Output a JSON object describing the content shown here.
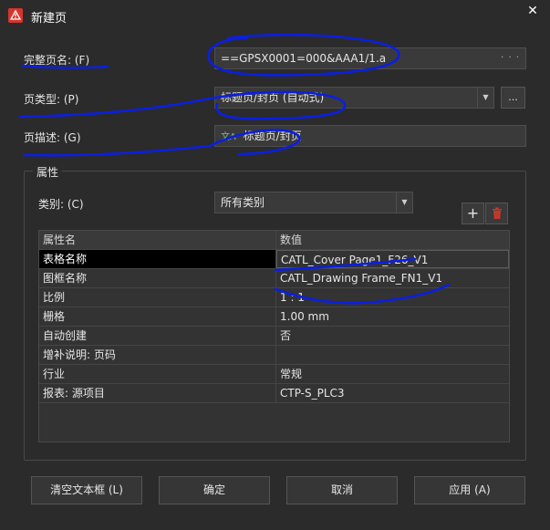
{
  "window": {
    "title": "新建页"
  },
  "form": {
    "full_page_name": {
      "label": "完整页名: (F)",
      "value": "==GPSX0001=000&AAA1/1.a"
    },
    "page_type": {
      "label": "页类型: (P)",
      "value": "标题页/封页 (自动式)"
    },
    "page_description": {
      "label": "页描述: (G)",
      "value": "标题页/封页"
    }
  },
  "properties": {
    "group_title": "属性",
    "category_label": "类别: (C)",
    "category_value": "所有类别",
    "columns": [
      "属性名",
      "数值"
    ],
    "rows": [
      {
        "name": "表格名称",
        "value": "CATL_Cover Page1_F26_V1"
      },
      {
        "name": "图框名称",
        "value": "CATL_Drawing Frame_FN1_V1"
      },
      {
        "name": "比例",
        "value": "1 : 1"
      },
      {
        "name": "栅格",
        "value": "1.00 mm"
      },
      {
        "name": "自动创建",
        "value": "否"
      },
      {
        "name": "增补说明: 页码",
        "value": ""
      },
      {
        "name": "行业",
        "value": "常规"
      },
      {
        "name": "报表: 源项目",
        "value": "CTP-S_PLC3"
      }
    ]
  },
  "buttons": {
    "clear": "清空文本框 (L)",
    "ok": "确定",
    "cancel": "取消",
    "apply": "应用 (A)"
  },
  "icons": {
    "app": "warning-triangle-icon",
    "close": "close-icon",
    "add": "plus-icon",
    "delete": "trash-icon",
    "more": "ellipsis-icon",
    "lang": "multilingual-icon"
  },
  "colors": {
    "app_icon_red": "#d9342b",
    "delete_red": "#c0392b",
    "ink_blue": "#0b1fe0"
  }
}
